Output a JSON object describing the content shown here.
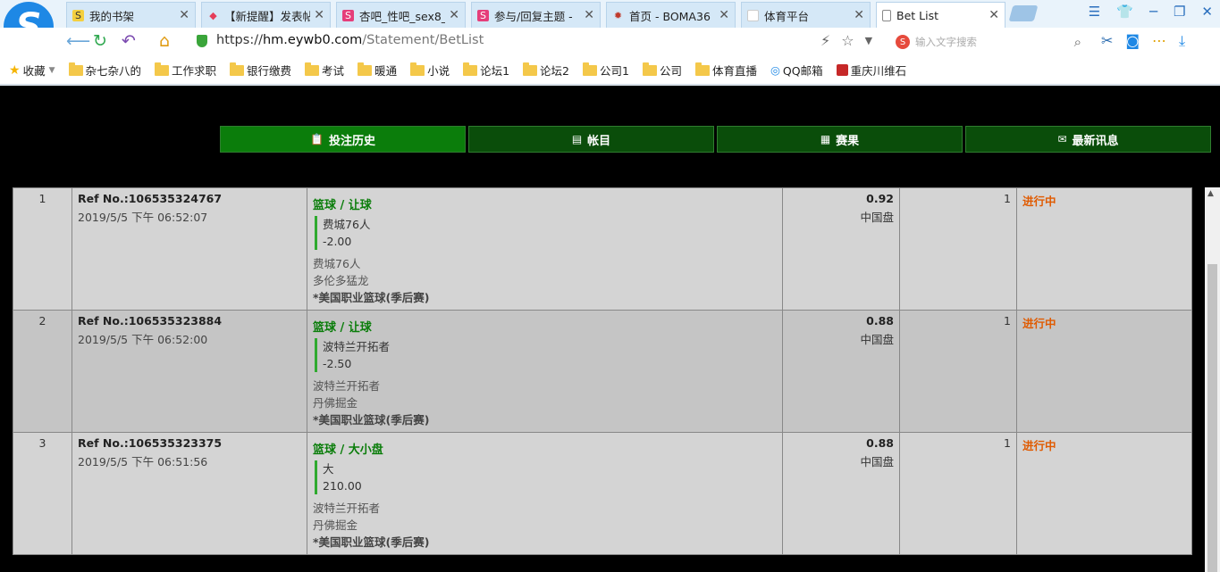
{
  "browser": {
    "tabs": [
      {
        "label": "我的书架",
        "icon": "S",
        "active": false
      },
      {
        "label": "【新提醒】发表帖",
        "icon": "◆",
        "active": false
      },
      {
        "label": "杏吧_性吧_sex8_",
        "icon": "S",
        "active": false
      },
      {
        "label": "参与/回复主题 -",
        "icon": "S",
        "active": false
      },
      {
        "label": "首页 - BOMA36",
        "icon": "✹",
        "active": false
      },
      {
        "label": "体育平台",
        "icon": "",
        "active": false
      },
      {
        "label": "Bet List",
        "icon": "",
        "active": true
      }
    ],
    "url_scheme": "https://",
    "url_host": "hm.eywb0.com",
    "url_path": "/Statement/BetList",
    "search_placeholder": "输入文字搜索",
    "bookmarks": [
      {
        "label": "收藏",
        "type": "star"
      },
      {
        "label": "杂七杂八的",
        "type": "folder"
      },
      {
        "label": "工作求职",
        "type": "folder"
      },
      {
        "label": "银行缴费",
        "type": "folder"
      },
      {
        "label": "考试",
        "type": "folder"
      },
      {
        "label": "暖通",
        "type": "folder"
      },
      {
        "label": "小说",
        "type": "folder"
      },
      {
        "label": "论坛1",
        "type": "folder"
      },
      {
        "label": "论坛2",
        "type": "folder"
      },
      {
        "label": "公司1",
        "type": "folder"
      },
      {
        "label": "公司",
        "type": "folder"
      },
      {
        "label": "体育直播",
        "type": "folder"
      },
      {
        "label": "QQ邮箱",
        "type": "qq"
      },
      {
        "label": "重庆川维石",
        "type": "site"
      }
    ]
  },
  "nav": {
    "items": [
      {
        "label": "投注历史",
        "icon": "📋",
        "active": true
      },
      {
        "label": "帐目",
        "icon": "▤",
        "active": false
      },
      {
        "label": "赛果",
        "icon": "▦",
        "active": false
      },
      {
        "label": "最新讯息",
        "icon": "✉",
        "active": false
      }
    ]
  },
  "bets": [
    {
      "no": "1",
      "ref": "Ref No.:106535324767",
      "time": "2019/5/5 下午 06:52:07",
      "sport": "篮球 / 让球",
      "pick": "费城76人",
      "line": "-2.00",
      "team_home": "费城76人",
      "team_away": "多伦多猛龙",
      "league": "*美国职业篮球(季后赛)",
      "odds": "0.92",
      "odds_type": "中国盘",
      "stake": "1",
      "status": "进行中"
    },
    {
      "no": "2",
      "ref": "Ref No.:106535323884",
      "time": "2019/5/5 下午 06:52:00",
      "sport": "篮球 / 让球",
      "pick": "波特兰开拓者",
      "line": "-2.50",
      "team_home": "波特兰开拓者",
      "team_away": "丹佛掘金",
      "league": "*美国职业篮球(季后赛)",
      "odds": "0.88",
      "odds_type": "中国盘",
      "stake": "1",
      "status": "进行中"
    },
    {
      "no": "3",
      "ref": "Ref No.:106535323375",
      "time": "2019/5/5 下午 06:51:56",
      "sport": "篮球 / 大小盘",
      "pick": "大",
      "line": "210.00",
      "team_home": "波特兰开拓者",
      "team_away": "丹佛掘金",
      "league": "*美国职业篮球(季后赛)",
      "odds": "0.88",
      "odds_type": "中国盘",
      "stake": "1",
      "status": "进行中"
    }
  ]
}
